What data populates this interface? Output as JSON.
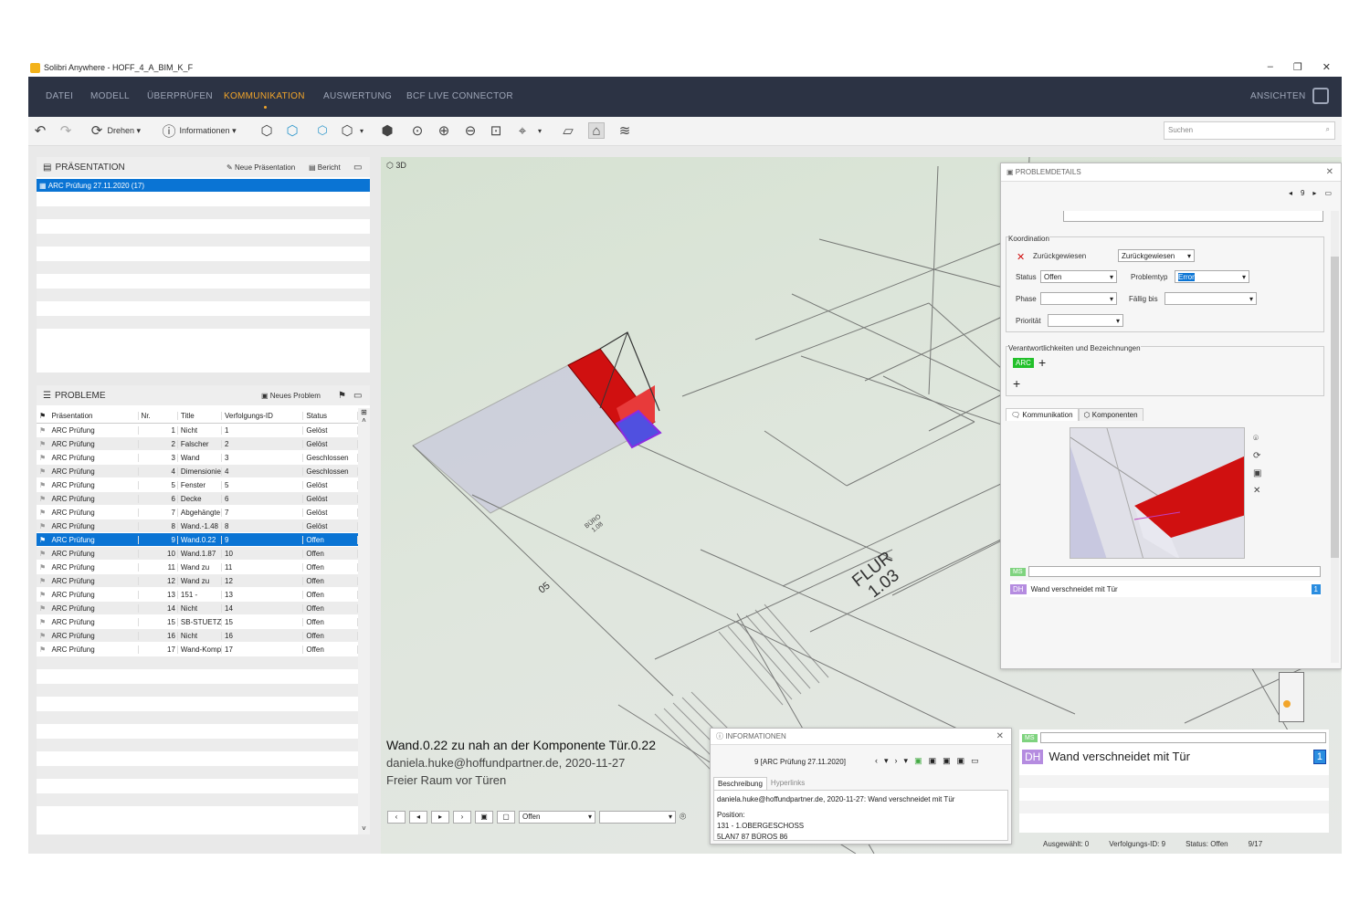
{
  "window": {
    "title": "Solibri Anywhere - HOFF_4_A_BIM_K_F"
  },
  "menu": {
    "items": [
      "DATEI",
      "MODELL",
      "ÜBERPRÜFEN",
      "KOMMUNIKATION",
      "AUSWERTUNG",
      "BCF LIVE CONNECTOR"
    ],
    "active": "KOMMUNIKATION",
    "right": "ANSICHTEN"
  },
  "toolbar": {
    "rotate_label": "Drehen",
    "info_label": "Informationen",
    "search_placeholder": "Suchen"
  },
  "presentation": {
    "title": "PRÄSENTATION",
    "new_label": "Neue Präsentation",
    "report_label": "Bericht",
    "items": [
      "ARC Prüfung 27.11.2020 (17)"
    ]
  },
  "problems": {
    "title": "PROBLEME",
    "new_label": "Neues Problem",
    "columns": [
      "Präsentation",
      "Nr.",
      "Title",
      "Verfolgungs-ID",
      "Status"
    ],
    "rows": [
      [
        "ARC Prüfung",
        "1",
        "Nicht",
        "1",
        "Gelöst"
      ],
      [
        "ARC Prüfung",
        "2",
        "Falscher",
        "2",
        "Gelöst"
      ],
      [
        "ARC Prüfung",
        "3",
        "Wand",
        "3",
        "Geschlossen"
      ],
      [
        "ARC Prüfung",
        "4",
        "Dimensionie",
        "4",
        "Geschlossen"
      ],
      [
        "ARC Prüfung",
        "5",
        "Fenster",
        "5",
        "Gelöst"
      ],
      [
        "ARC Prüfung",
        "6",
        "Decke",
        "6",
        "Gelöst"
      ],
      [
        "ARC Prüfung",
        "7",
        "Abgehängte",
        "7",
        "Gelöst"
      ],
      [
        "ARC Prüfung",
        "8",
        "Wand.-1.48",
        "8",
        "Gelöst"
      ],
      [
        "ARC Prüfung",
        "9",
        "Wand.0.22",
        "9",
        "Offen"
      ],
      [
        "ARC Prüfung",
        "10",
        "Wand.1.87",
        "10",
        "Offen"
      ],
      [
        "ARC Prüfung",
        "11",
        "Wand zu",
        "11",
        "Offen"
      ],
      [
        "ARC Prüfung",
        "12",
        "Wand zu",
        "12",
        "Offen"
      ],
      [
        "ARC Prüfung",
        "13",
        "151 -",
        "13",
        "Offen"
      ],
      [
        "ARC Prüfung",
        "14",
        "Nicht",
        "14",
        "Offen"
      ],
      [
        "ARC Prüfung",
        "15",
        "SB-STUETZE\\",
        "15",
        "Offen"
      ],
      [
        "ARC Prüfung",
        "16",
        "Nicht",
        "16",
        "Offen"
      ],
      [
        "ARC Prüfung",
        "17",
        "Wand-Komp",
        "17",
        "Offen"
      ]
    ]
  },
  "view": {
    "label": "3D",
    "room1_name": "FLUR",
    "room1_num": "1.03",
    "room2_name": "BÜRO",
    "room2_num": "1.08",
    "dim": "05",
    "caption_title": "Wand.0.22 zu nah an der Komponente Tür.0.22",
    "caption_author": "daniela.huke@hoffundpartner.de, 2020-11-27",
    "caption_desc": "Freier Raum vor Türen",
    "status_select": "Offen"
  },
  "details": {
    "title": "PROBLEMDETAILS",
    "page": "9",
    "coord_title": "Koordination",
    "rejected_label": "Zurückgewiesen",
    "rejected_select": "Zurückgewiesen",
    "status_label": "Status",
    "status_value": "Offen",
    "problemtype_label": "Problemtyp",
    "problemtype_value": "Error",
    "phase_label": "Phase",
    "due_label": "Fällig bis",
    "priority_label": "Priorität",
    "resp_title": "Verantwortlichkeiten und Bezeichnungen",
    "resp_badge": "ARC",
    "tab_comm": "Kommunikation",
    "tab_comp": "Komponenten",
    "comment_author": "DH",
    "comment_text": "Wand verschneidet mit Tür",
    "comment_count": "1",
    "input_badge": "MS"
  },
  "info": {
    "title": "INFORMATIONEN",
    "selector": "9 [ARC Prüfung 27.11.2020]",
    "tab_desc": "Beschreibung",
    "tab_links": "Hyperlinks",
    "line1": "daniela.huke@hoffundpartner.de, 2020-11-27: Wand verschneidet mit Tür",
    "line2": "Position:",
    "line3": "131 - 1.OBERGESCHOSS",
    "line4": "5LAN7 87 BÜROS 86"
  },
  "comment_panel": {
    "input_badge": "MS",
    "author": "DH",
    "text": "Wand verschneidet mit Tür",
    "count": "1"
  },
  "statusbar": {
    "selected": "Ausgewählt: 0",
    "tracking": "Verfolgungs-ID: 9",
    "status": "Status: Offen",
    "count": "9/17"
  },
  "colors": {
    "menubar": "#2c3344",
    "accent": "#f2a52a",
    "selection": "#0a74d4",
    "clash": "#d01010",
    "arc_badge": "#22c02a",
    "dh_badge": "#b58ce0",
    "ms_badge": "#7fd37f"
  }
}
